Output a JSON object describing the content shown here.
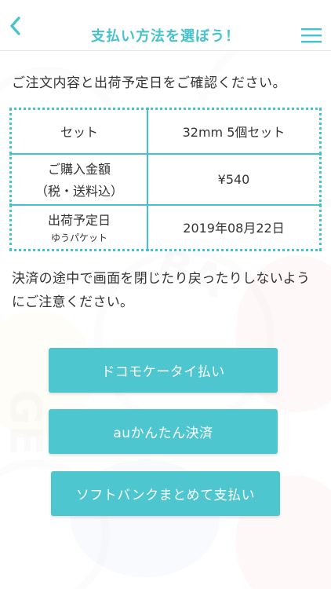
{
  "header": {
    "title": "支払い方法を選ぼう！"
  },
  "intro": "ご注文内容と出荷予定日をご確認ください。",
  "order": {
    "rows": [
      {
        "label": "セット",
        "value": "32mm 5個セット"
      },
      {
        "label": "ご購入金額",
        "label_line2": "（税・送料込）",
        "value": "¥540"
      },
      {
        "label": "出荷予定日",
        "sublabel": "ゆうパケット",
        "value": "2019年08月22日"
      }
    ]
  },
  "notice": "決済の途中で画面を閉じたり戻ったりしないようにご注意ください。",
  "payment": {
    "docomo_label": "ドコモケータイ払い",
    "au_label": "auかんたん決済",
    "softbank_label": "ソフトバンクまとめて支払い"
  },
  "colors": {
    "accent": "#45c2cc",
    "button": "#4ec6cf"
  },
  "icons": {
    "back": "chevron-left-icon",
    "menu": "hamburger-menu-icon"
  }
}
